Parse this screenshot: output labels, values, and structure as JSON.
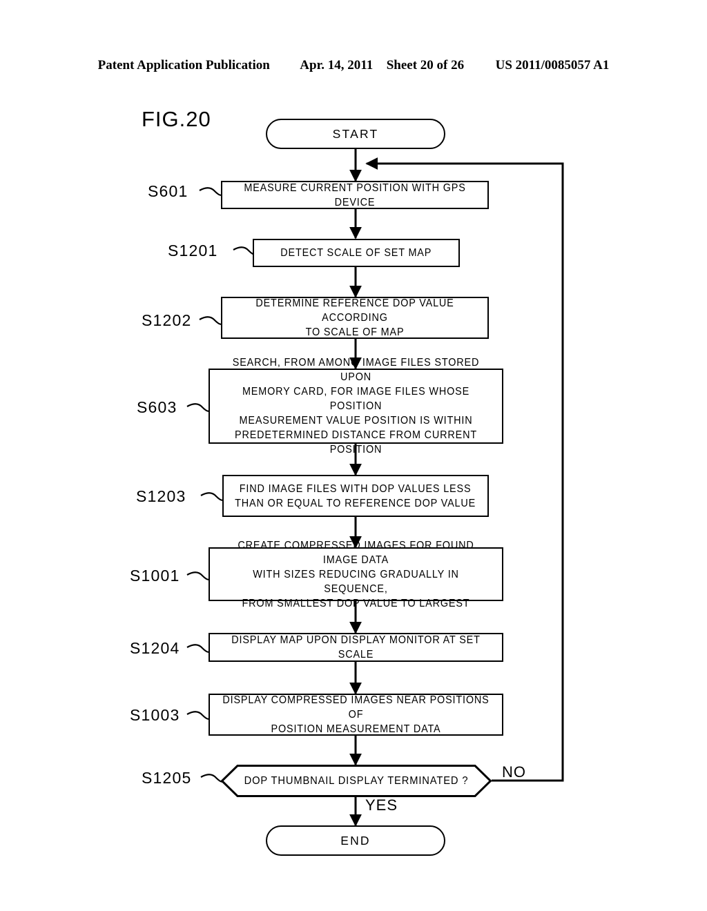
{
  "header": {
    "publication": "Patent Application Publication",
    "date": "Apr. 14, 2011",
    "sheet": "Sheet 20 of 26",
    "patent_number": "US 2011/0085057 A1"
  },
  "figure": {
    "label": "FIG.20"
  },
  "flowchart": {
    "start": {
      "id": "",
      "text": "START"
    },
    "end": {
      "id": "",
      "text": "END"
    },
    "steps": [
      {
        "id": "S601",
        "text": "MEASURE CURRENT POSITION WITH GPS DEVICE"
      },
      {
        "id": "S1201",
        "text": "DETECT SCALE OF SET MAP"
      },
      {
        "id": "S1202",
        "text": "DETERMINE REFERENCE DOP VALUE ACCORDING\nTO SCALE OF MAP"
      },
      {
        "id": "S603",
        "text": "SEARCH, FROM AMONG IMAGE FILES STORED UPON\nMEMORY CARD, FOR IMAGE FILES WHOSE POSITION\nMEASUREMENT VALUE POSITION IS WITHIN\nPREDETERMINED DISTANCE FROM CURRENT POSITION"
      },
      {
        "id": "S1203",
        "text": "FIND IMAGE FILES WITH DOP VALUES LESS\nTHAN OR EQUAL TO REFERENCE DOP VALUE"
      },
      {
        "id": "S1001",
        "text": "CREATE COMPRESSED IMAGES FOR FOUND IMAGE DATA\nWITH SIZES REDUCING GRADUALLY IN SEQUENCE,\nFROM SMALLEST DOP VALUE TO LARGEST"
      },
      {
        "id": "S1204",
        "text": "DISPLAY MAP UPON DISPLAY MONITOR AT SET SCALE"
      },
      {
        "id": "S1003",
        "text": "DISPLAY COMPRESSED IMAGES NEAR POSITIONS OF\nPOSITION MEASUREMENT DATA"
      }
    ],
    "decision": {
      "id": "S1205",
      "text": "DOP THUMBNAIL DISPLAY TERMINATED ?",
      "branch_yes": "YES",
      "branch_no": "NO"
    }
  }
}
